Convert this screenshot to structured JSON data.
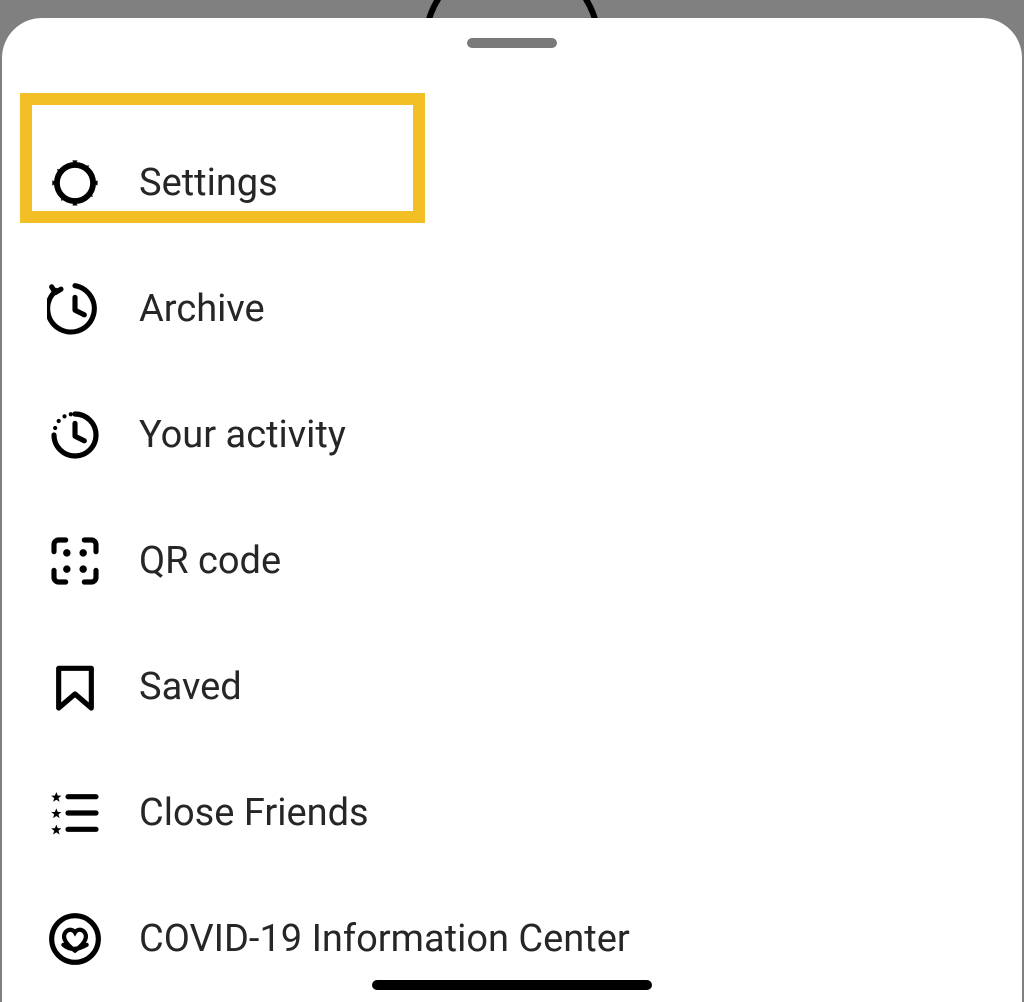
{
  "menu": {
    "items": [
      {
        "label": "Settings"
      },
      {
        "label": "Archive"
      },
      {
        "label": "Your activity"
      },
      {
        "label": "QR code"
      },
      {
        "label": "Saved"
      },
      {
        "label": "Close Friends"
      },
      {
        "label": "COVID-19 Information Center"
      }
    ]
  }
}
